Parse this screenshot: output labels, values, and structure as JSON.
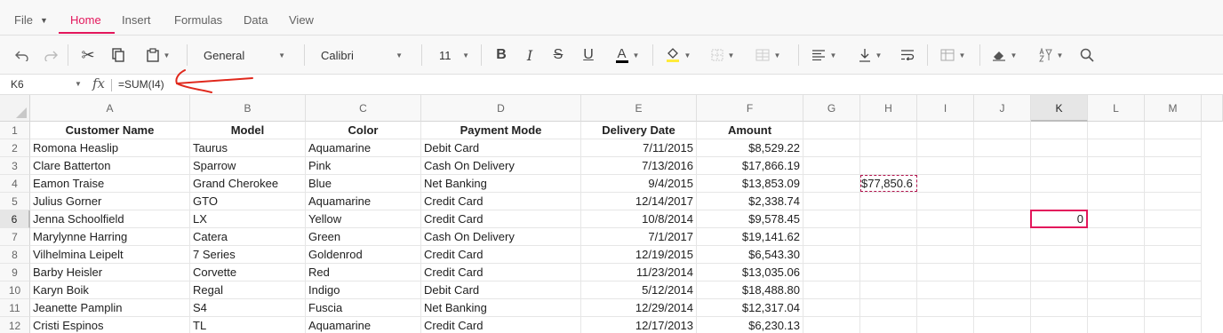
{
  "ribbon": {
    "tabs": [
      {
        "label": "File",
        "active": false
      },
      {
        "label": "Home",
        "active": true
      },
      {
        "label": "Insert",
        "active": false
      },
      {
        "label": "Formulas",
        "active": false
      },
      {
        "label": "Data",
        "active": false
      },
      {
        "label": "View",
        "active": false
      }
    ],
    "accent": "#e3165b"
  },
  "toolbar": {
    "number_format": "General",
    "font_family": "Calibri",
    "font_size": "11",
    "bold_label": "B",
    "italic_label": "I",
    "strike_label": "S",
    "underline_label": "U",
    "font_color_label": "A",
    "font_color": "#000000",
    "fill_color": "#ffeb3b"
  },
  "formula_bar": {
    "name_box": "K6",
    "fx_label": "fx",
    "formula": "=SUM(I4)"
  },
  "sheet": {
    "columns": [
      "A",
      "B",
      "C",
      "D",
      "E",
      "F",
      "G",
      "H",
      "I",
      "J",
      "K",
      "L",
      "M"
    ],
    "selected_column": "K",
    "rows": [
      "1",
      "2",
      "3",
      "4",
      "5",
      "6",
      "7",
      "8",
      "9",
      "10",
      "11",
      "12"
    ],
    "selected_row": "6",
    "headers": [
      "Customer Name",
      "Model",
      "Color",
      "Payment Mode",
      "Delivery Date",
      "Amount"
    ],
    "data": [
      [
        "Romona Heaslip",
        "Taurus",
        "Aquamarine",
        "Debit Card",
        "7/11/2015",
        "$8,529.22"
      ],
      [
        "Clare Batterton",
        "Sparrow",
        "Pink",
        "Cash On Delivery",
        "7/13/2016",
        "$17,866.19"
      ],
      [
        "Eamon Traise",
        "Grand Cherokee",
        "Blue",
        "Net Banking",
        "9/4/2015",
        "$13,853.09"
      ],
      [
        "Julius Gorner",
        "GTO",
        "Aquamarine",
        "Credit Card",
        "12/14/2017",
        "$2,338.74"
      ],
      [
        "Jenna Schoolfield",
        "LX",
        "Yellow",
        "Credit Card",
        "10/8/2014",
        "$9,578.45"
      ],
      [
        "Marylynne Harring",
        "Catera",
        "Green",
        "Cash On Delivery",
        "7/1/2017",
        "$19,141.62"
      ],
      [
        "Vilhelmina Leipelt",
        "7 Series",
        "Goldenrod",
        "Credit Card",
        "12/19/2015",
        "$6,543.30"
      ],
      [
        "Barby Heisler",
        "Corvette",
        "Red",
        "Credit Card",
        "11/23/2014",
        "$13,035.06"
      ],
      [
        "Karyn Boik",
        "Regal",
        "Indigo",
        "Debit Card",
        "5/12/2014",
        "$18,488.80"
      ],
      [
        "Jeanette Pamplin",
        "S4",
        "Fuscia",
        "Net Banking",
        "12/29/2014",
        "$12,317.04"
      ],
      [
        "Cristi Espinos",
        "TL",
        "Aquamarine",
        "Credit Card",
        "12/17/2013",
        "$6,230.13"
      ]
    ],
    "copied_cell": {
      "ref": "H4",
      "value": "$77,850.6"
    },
    "active_cell": {
      "ref": "K6",
      "value": "0"
    }
  }
}
